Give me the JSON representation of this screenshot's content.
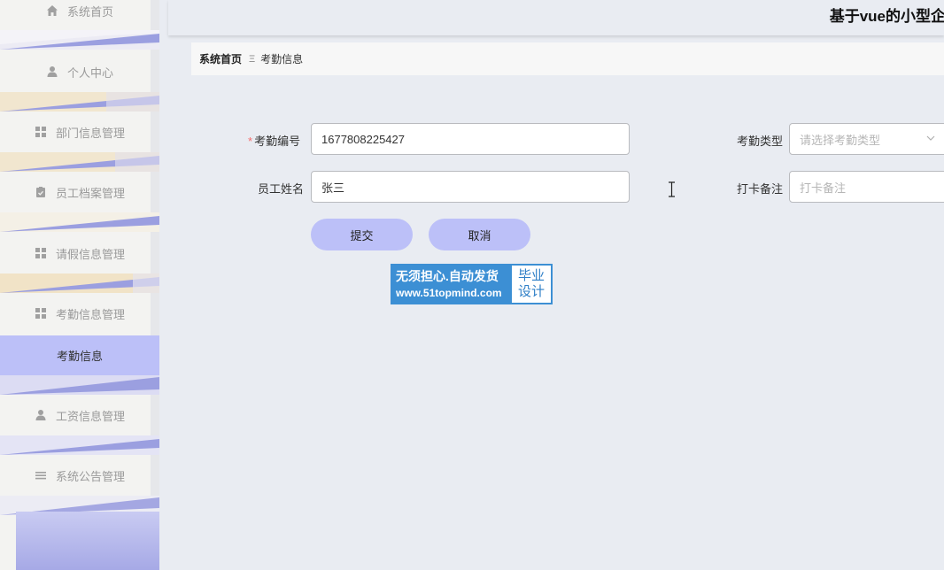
{
  "sidebar": {
    "items": [
      {
        "label": "系统首页",
        "icon": "home-icon"
      },
      {
        "label": "个人中心",
        "icon": "user-icon"
      },
      {
        "label": "部门信息管理",
        "icon": "grid-icon"
      },
      {
        "label": "员工档案管理",
        "icon": "clipboard-icon"
      },
      {
        "label": "请假信息管理",
        "icon": "grid-icon"
      },
      {
        "label": "考勤信息管理",
        "icon": "grid-icon"
      },
      {
        "label": "考勤信息",
        "active": true
      },
      {
        "label": "工资信息管理",
        "icon": "user-icon"
      },
      {
        "label": "系统公告管理",
        "icon": "list-icon"
      }
    ]
  },
  "header": {
    "title": "基于vue的小型企"
  },
  "breadcrumb": {
    "home": "系统首页",
    "separator": "Ξ",
    "current": "考勤信息"
  },
  "form": {
    "attendance_no": {
      "label": "考勤编号",
      "value": "1677808225427",
      "required": true
    },
    "attendance_type": {
      "label": "考勤类型",
      "placeholder": "请选择考勤类型"
    },
    "employee_name": {
      "label": "员工姓名",
      "value": "张三"
    },
    "punch_note": {
      "label": "打卡备注",
      "placeholder": "打卡备注"
    },
    "submit_label": "提交",
    "cancel_label": "取消"
  },
  "watermark": {
    "line1": "无须担心.自动发货",
    "line2": "www.51topmind.com",
    "badge_line1": "毕业",
    "badge_line2": "设计"
  },
  "colors": {
    "accent": "#bcc0f8",
    "background": "#e9ecf2",
    "required": "#f56c6c"
  }
}
